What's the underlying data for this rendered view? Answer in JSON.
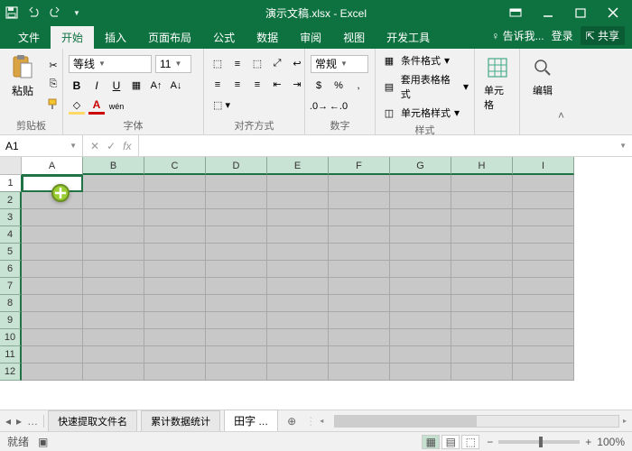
{
  "title": "演示文稿.xlsx - Excel",
  "tabs": {
    "file": "文件",
    "home": "开始",
    "insert": "插入",
    "layout": "页面布局",
    "formula": "公式",
    "data": "数据",
    "review": "审阅",
    "view": "视图",
    "dev": "开发工具",
    "tell": "告诉我...",
    "login": "登录",
    "share": "共享"
  },
  "ribbon": {
    "clipboard": {
      "paste": "粘贴",
      "label": "剪贴板"
    },
    "font": {
      "name": "等线",
      "size": "11",
      "label": "字体"
    },
    "align": {
      "label": "对齐方式"
    },
    "number": {
      "format": "常规",
      "label": "数字"
    },
    "styles": {
      "cond": "条件格式",
      "table": "套用表格格式",
      "cell": "单元格样式",
      "label": "样式"
    },
    "cells": {
      "label": "单元格"
    },
    "edit": {
      "label": "编辑"
    }
  },
  "namebox": "A1",
  "cols": [
    "A",
    "B",
    "C",
    "D",
    "E",
    "F",
    "G",
    "H",
    "I"
  ],
  "rows": [
    "1",
    "2",
    "3",
    "4",
    "5",
    "6",
    "7",
    "8",
    "9",
    "10",
    "11",
    "12"
  ],
  "wstabs": {
    "t1": "快速提取文件名",
    "t2": "累计数据统计",
    "t3": "田字"
  },
  "status": {
    "ready": "就绪",
    "zoom": "100%"
  }
}
